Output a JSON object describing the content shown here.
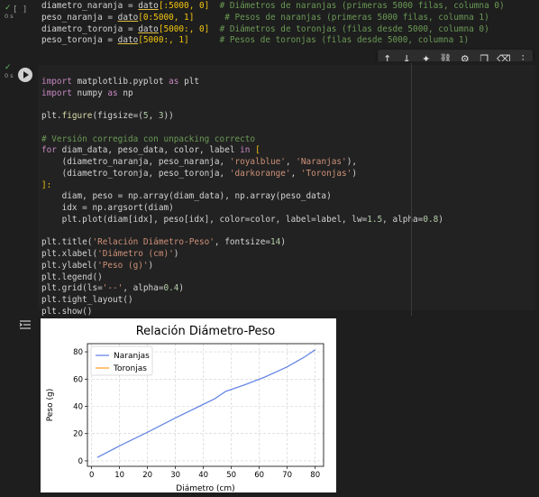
{
  "cell1": {
    "status": "✓",
    "duration": "0 s",
    "bracket": "[ ]",
    "lines": [
      {
        "var": "diametro_naranja",
        "op": " = ",
        "src": "dato",
        "idx": "[:5000, 0]",
        "pad": "  ",
        "comment": "# Diámetros de naranjas (primeras 5000 filas, columna 0)"
      },
      {
        "var": "peso_naranja",
        "op": " = ",
        "src": "dato",
        "idx": "[0:5000, 1]",
        "pad": "      ",
        "comment": "# Pesos de naranjas (primeras 5000 filas, columna 1)"
      },
      {
        "var": "diametro_toronja",
        "op": " = ",
        "src": "dato",
        "idx": "[5000:, 0]",
        "pad": "  ",
        "comment": "# Diámetros de toronjas (filas desde 5000, columna 0)"
      },
      {
        "var": "peso_toronja",
        "op": " = ",
        "src": "dato",
        "idx": "[5000:, 1]",
        "pad": "      ",
        "comment": "# Pesos de toronjas (filas desde 5000, columna 1)"
      }
    ]
  },
  "cell2": {
    "status": "✓",
    "duration": "0 s",
    "code": {
      "l1_kw": "import",
      "l1_rest": " matplotlib.pyplot ",
      "l1_as": "as",
      "l1_alias": " plt",
      "l2_kw": "import",
      "l2_rest": " numpy ",
      "l2_as": "as",
      "l2_alias": " np",
      "l4_a": "plt.",
      "l4_fn": "figure",
      "l4_b": "(figsize=(",
      "l4_n1": "5",
      "l4_c": ", ",
      "l4_n2": "3",
      "l4_d": "))",
      "l6_comment": "# Versión corregida con unpacking correcto",
      "l7_for": "for",
      "l7_rest": " diam_data, peso_data, color, label ",
      "l7_in": "in",
      "l7_br": " [",
      "l8_a": "    (diametro_naranja, peso_naranja, ",
      "l8_s1": "'royalblue'",
      "l8_c": ", ",
      "l8_s2": "'Naranjas'",
      "l8_d": "),",
      "l9_a": "    (diametro_toronja, peso_toronja, ",
      "l9_s1": "'darkorange'",
      "l9_c": ", ",
      "l9_s2": "'Toronjas'",
      "l9_d": ")",
      "l10": "]:",
      "l11": "    diam, peso = np.array(diam_data), np.array(peso_data)",
      "l12": "    idx = np.argsort(diam)",
      "l13_a": "    plt.plot(diam[idx], peso[idx], color=color, label=label, lw=",
      "l13_n1": "1.5",
      "l13_b": ", alpha=",
      "l13_n2": "0.8",
      "l13_c": ")",
      "l15_a": "plt.title(",
      "l15_s": "'Relación Diámetro-Peso'",
      "l15_b": ", fontsize=",
      "l15_n": "14",
      "l15_c": ")",
      "l16_a": "plt.xlabel(",
      "l16_s": "'Diámetro (cm)'",
      "l16_b": ")",
      "l17_a": "plt.ylabel(",
      "l17_s": "'Peso (g)'",
      "l17_b": ")",
      "l18": "plt.legend()",
      "l19_a": "plt.grid(ls=",
      "l19_s": "'--'",
      "l19_b": ", alpha=",
      "l19_n": "0.4",
      "l19_c": ")",
      "l20": "plt.tight_layout()",
      "l21": "plt.show()"
    }
  },
  "toolbar": {
    "icons": [
      "arrow-up-icon",
      "arrow-down-icon",
      "sparkle-icon",
      "link-icon",
      "gear-icon",
      "mirror-icon",
      "delete-icon",
      "more-icon"
    ]
  },
  "colors": {
    "background": "#1e1e1e",
    "keyword": "#c586c0",
    "string": "#ce9178",
    "comment": "#6a9955",
    "number": "#b5cea8",
    "series1": "#4169e1",
    "series2": "#ff8c00"
  },
  "chart_data": {
    "type": "line",
    "title": "Relación Diámetro-Peso",
    "xlabel": "Diámetro (cm)",
    "ylabel": "Peso (g)",
    "xlim": [
      -1.5,
      83
    ],
    "ylim": [
      -4,
      86
    ],
    "xticks": [
      0,
      10,
      20,
      30,
      40,
      50,
      60,
      70,
      80
    ],
    "yticks": [
      0,
      20,
      40,
      60,
      80
    ],
    "grid": true,
    "legend": "upper-left",
    "series": [
      {
        "name": "Naranjas",
        "color": "#4169e1",
        "x": [
          2,
          10,
          20,
          30,
          40,
          44,
          48,
          55,
          62,
          70,
          76,
          80
        ],
        "y": [
          2.5,
          11,
          21,
          31.5,
          41.5,
          45.5,
          51,
          56,
          61.5,
          69,
          76,
          81.5
        ]
      },
      {
        "name": "Toronjas",
        "color": "#ff8c00",
        "x": [],
        "y": []
      }
    ]
  }
}
